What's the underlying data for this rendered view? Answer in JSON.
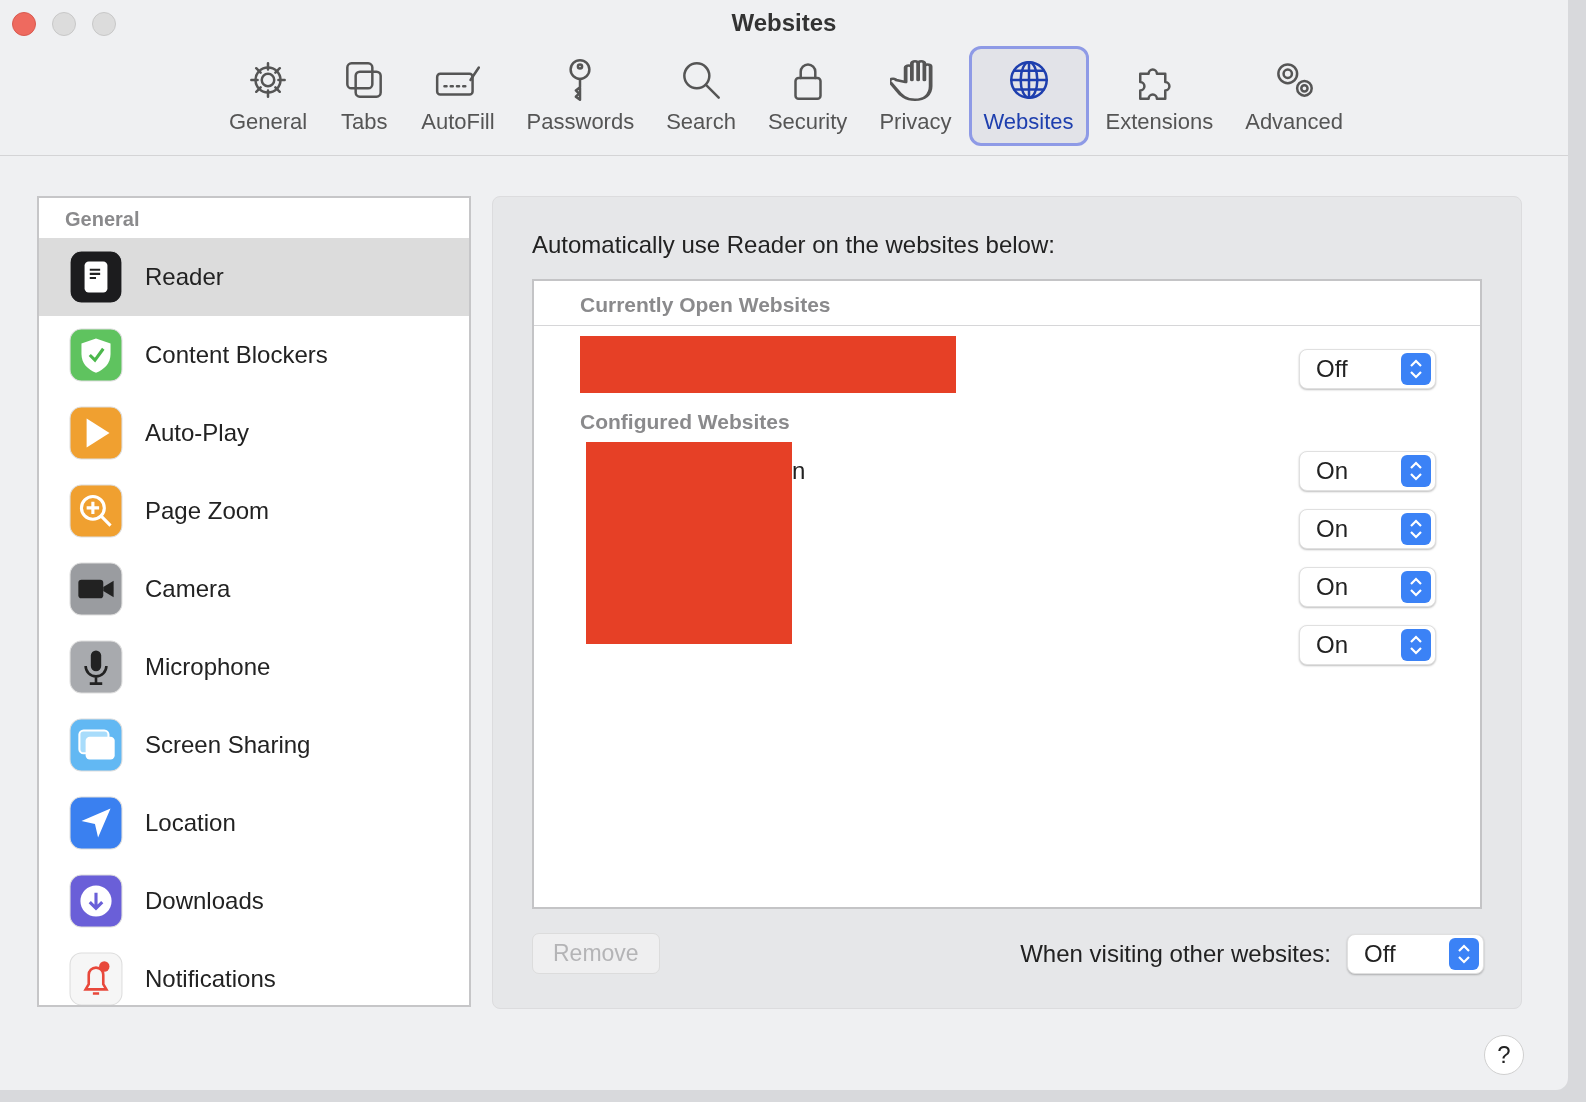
{
  "window": {
    "title": "Websites"
  },
  "toolbar": [
    {
      "label": "General",
      "selected": false
    },
    {
      "label": "Tabs",
      "selected": false
    },
    {
      "label": "AutoFill",
      "selected": false
    },
    {
      "label": "Passwords",
      "selected": false
    },
    {
      "label": "Search",
      "selected": false
    },
    {
      "label": "Security",
      "selected": false
    },
    {
      "label": "Privacy",
      "selected": false
    },
    {
      "label": "Websites",
      "selected": true
    },
    {
      "label": "Extensions",
      "selected": false
    },
    {
      "label": "Advanced",
      "selected": false
    }
  ],
  "sidebar": {
    "heading": "General",
    "items": [
      {
        "label": "Reader",
        "selected": true
      },
      {
        "label": "Content Blockers",
        "selected": false
      },
      {
        "label": "Auto-Play",
        "selected": false
      },
      {
        "label": "Page Zoom",
        "selected": false
      },
      {
        "label": "Camera",
        "selected": false
      },
      {
        "label": "Microphone",
        "selected": false
      },
      {
        "label": "Screen Sharing",
        "selected": false
      },
      {
        "label": "Location",
        "selected": false
      },
      {
        "label": "Downloads",
        "selected": false
      },
      {
        "label": "Notifications",
        "selected": false
      }
    ]
  },
  "panel": {
    "prompt": "Automatically use Reader on the websites below:",
    "table": {
      "sections": [
        {
          "heading": "Currently Open Websites",
          "redacted": true,
          "rows": [
            {
              "value": "Off"
            }
          ]
        },
        {
          "heading": "Configured Websites",
          "redacted": true,
          "rows": [
            {
              "site": "n",
              "value": "On"
            },
            {
              "value": "On"
            },
            {
              "value": "On"
            },
            {
              "value": "On"
            }
          ]
        }
      ]
    },
    "remove_button": {
      "label": "Remove",
      "disabled": true
    },
    "other_label": "When visiting other websites:",
    "other_value": "Off"
  },
  "help": "?"
}
